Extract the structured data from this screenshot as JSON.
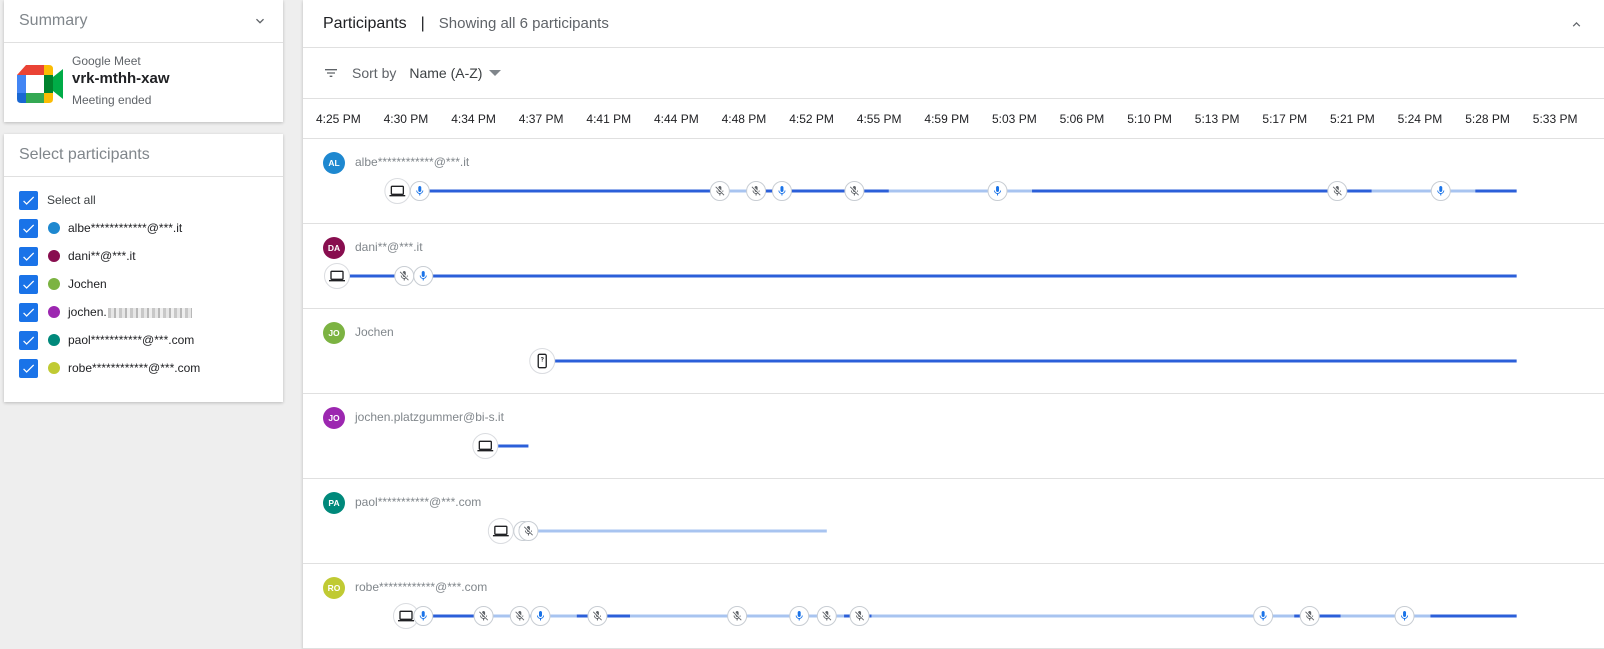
{
  "summary": {
    "title": "Summary",
    "app_name": "Google Meet",
    "meeting_code": "vrk-mthh-xaw",
    "status": "Meeting ended"
  },
  "select": {
    "title": "Select participants",
    "select_all_label": "Select all",
    "items": [
      {
        "label": "albe************@***.it",
        "color": "#1e88d0",
        "checked": true
      },
      {
        "label": "dani**@***.it",
        "color": "#880e4f",
        "checked": true
      },
      {
        "label": "Jochen",
        "color": "#7cb342",
        "checked": true
      },
      {
        "label": "jochen.",
        "color": "#9c27b0",
        "checked": true,
        "obscured": true
      },
      {
        "label": "paol***********@***.com",
        "color": "#00897b",
        "checked": true
      },
      {
        "label": "robe************@***.com",
        "color": "#c0ca33",
        "checked": true
      }
    ]
  },
  "participants": {
    "title": "Participants",
    "separator": "|",
    "count_text": "Showing all 6 participants",
    "sort_label": "Sort by",
    "sort_value": "Name (A-Z)",
    "timeline": {
      "start_min": 265,
      "end_min": 334,
      "ticks": [
        "4:25 PM",
        "4:30 PM",
        "4:34 PM",
        "4:37 PM",
        "4:41 PM",
        "4:44 PM",
        "4:48 PM",
        "4:52 PM",
        "4:55 PM",
        "4:59 PM",
        "5:03 PM",
        "5:06 PM",
        "5:10 PM",
        "5:13 PM",
        "5:17 PM",
        "5:21 PM",
        "5:24 PM",
        "5:28 PM",
        "5:33 PM"
      ]
    },
    "rows": [
      {
        "initials": "AL",
        "name": "albe************@***.it",
        "color": "#1e88d0",
        "device": "laptop",
        "device_t": 268.5,
        "segments": [
          [
            268.9,
            287.3,
            "on"
          ],
          [
            287.3,
            289.8,
            "off"
          ],
          [
            289.8,
            297.0,
            "on"
          ],
          [
            297.0,
            305.3,
            "off"
          ],
          [
            305.3,
            325.0,
            "on"
          ],
          [
            325.0,
            331.0,
            "off"
          ],
          [
            331.0,
            333.4,
            "on"
          ]
        ],
        "events": [
          [
            269.8,
            "mic-on"
          ],
          [
            287.2,
            "mic-off"
          ],
          [
            289.3,
            "mic-off"
          ],
          [
            290.8,
            "mic-on"
          ],
          [
            295.0,
            "mic-off"
          ],
          [
            303.3,
            "mic-on"
          ],
          [
            323.0,
            "mic-off"
          ],
          [
            329.0,
            "mic-on"
          ]
        ]
      },
      {
        "initials": "DA",
        "name": "dani**@***.it",
        "color": "#880e4f",
        "device": "laptop",
        "device_t": 265.0,
        "segments": [
          [
            265.6,
            333.4,
            "on"
          ]
        ],
        "events": [
          [
            268.9,
            "mic-off"
          ],
          [
            270.0,
            "mic-on"
          ]
        ]
      },
      {
        "initials": "JO",
        "name": "Jochen",
        "color": "#7cb342",
        "device": "phone",
        "device_t": 276.9,
        "segments": [
          [
            277.6,
            333.4,
            "on"
          ]
        ],
        "events": []
      },
      {
        "initials": "JO",
        "name": "jochen.platzgummer@bi-s.it",
        "color": "#9c27b0",
        "device": "laptop",
        "device_t": 273.6,
        "segments": [
          [
            274.2,
            276.1,
            "on"
          ]
        ],
        "events": []
      },
      {
        "initials": "PA",
        "name": "paol***********@***.com",
        "color": "#00897b",
        "device": "laptop",
        "device_t": 274.5,
        "segments": [
          [
            276.0,
            293.4,
            "off"
          ]
        ],
        "events": [
          [
            275.8,
            "mic-off"
          ],
          [
            276.1,
            "mic-off"
          ]
        ]
      },
      {
        "initials": "RO",
        "name": "robe************@***.com",
        "color": "#c0ca33",
        "device": "laptop",
        "device_t": 269.0,
        "segments": [
          [
            269.9,
            273.5,
            "on"
          ],
          [
            273.5,
            278.9,
            "off"
          ],
          [
            278.9,
            282.0,
            "on"
          ],
          [
            282.0,
            294.4,
            "off"
          ],
          [
            294.4,
            296.0,
            "on"
          ],
          [
            296.0,
            320.5,
            "off"
          ],
          [
            320.5,
            323.2,
            "on"
          ],
          [
            323.2,
            328.4,
            "off"
          ],
          [
            328.4,
            333.4,
            "on"
          ]
        ],
        "events": [
          [
            270.0,
            "mic-on"
          ],
          [
            273.5,
            "mic-off"
          ],
          [
            275.6,
            "mic-off"
          ],
          [
            276.8,
            "mic-on"
          ],
          [
            280.1,
            "mic-off"
          ],
          [
            288.2,
            "mic-off"
          ],
          [
            291.8,
            "mic-on"
          ],
          [
            293.4,
            "mic-off"
          ],
          [
            295.3,
            "mic-off"
          ],
          [
            318.7,
            "mic-on"
          ],
          [
            321.4,
            "mic-off"
          ],
          [
            326.9,
            "mic-on"
          ]
        ]
      }
    ]
  }
}
